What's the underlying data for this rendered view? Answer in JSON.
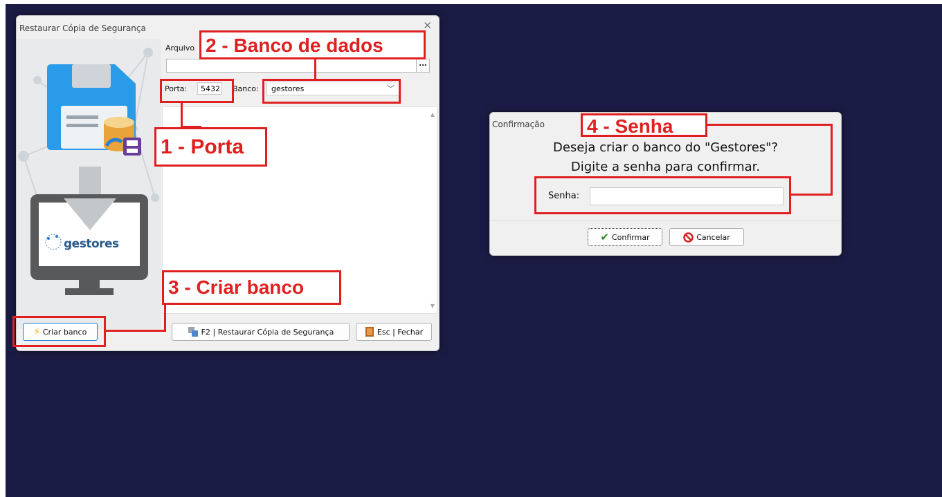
{
  "restore_dialog": {
    "title": "Restaurar Cópia de Segurança",
    "close_glyph": "✕",
    "arquivo_label": "Arquivo",
    "arquivo_value": "",
    "browse_label": "...",
    "porta_label": "Porta:",
    "porta_value": "5432",
    "banco_label": "Banco:",
    "banco_value": "gestores",
    "logo_text": "gestores",
    "buttons": {
      "criar_banco": "Criar banco",
      "restaurar": "F2 | Restaurar Cópia de Segurança",
      "fechar": "Esc | Fechar"
    }
  },
  "confirm_dialog": {
    "title": "Confirmação",
    "message_line1": "Deseja criar o banco do \"Gestores\"?",
    "message_line2": "Digite a senha para confirmar.",
    "senha_label": "Senha:",
    "senha_value": "",
    "confirm_label": "Confirmar",
    "cancel_label": "Cancelar"
  },
  "annotations": {
    "porta": "1 - Porta",
    "banco_de_dados": "2 - Banco de dados",
    "criar_banco": "3 - Criar banco",
    "senha": "4 - Senha"
  },
  "colors": {
    "desktop": "#1b1c45",
    "annotation": "#e02020",
    "disk_blue": "#2a9be8",
    "button_focus": "#1a7ed6"
  },
  "icons": {
    "save_disk": "floppy-disk-icon",
    "database": "database-icon",
    "download_arrow": "arrow-down-icon",
    "monitor": "monitor-icon",
    "lightning": "lightning-icon",
    "restore": "restore-icon",
    "exit": "exit-door-icon",
    "check": "check-icon",
    "cancel": "cancel-icon"
  }
}
